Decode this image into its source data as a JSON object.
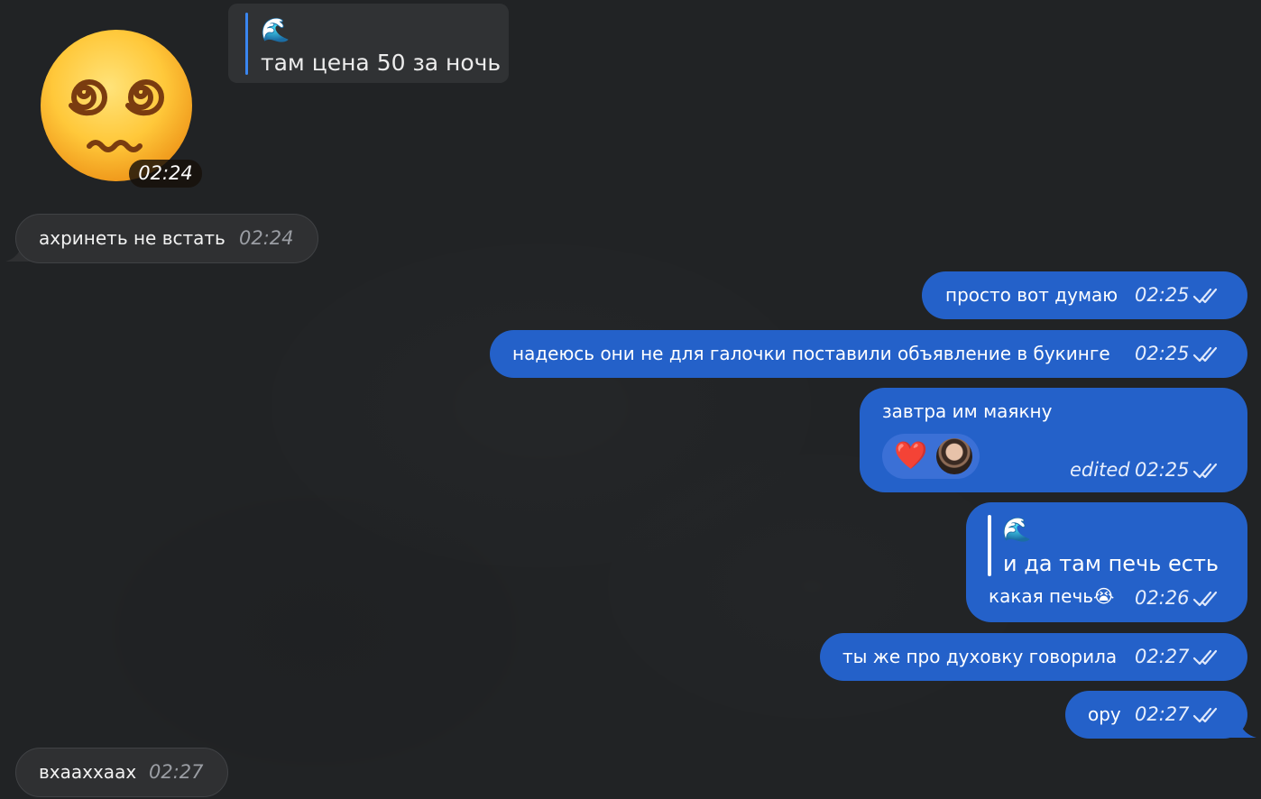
{
  "forwarded_quote": {
    "emoji": "🌊",
    "text": "там цена 50 за ночь"
  },
  "sticker": {
    "icon": "dizzy-face-sticker",
    "time": "02:24"
  },
  "messages_in": [
    {
      "text": "ахринеть не встать",
      "time": "02:24"
    },
    {
      "text": "вхааххаах",
      "time": "02:27"
    }
  ],
  "messages_out": [
    {
      "text": "просто вот думаю",
      "time": "02:25"
    },
    {
      "text": "надеюсь они не для галочки поставили объявление в букинге",
      "time": "02:25"
    },
    {
      "text": "завтра им маякну",
      "time": "02:25",
      "edited_label": "edited",
      "reaction": {
        "emoji": "❤️",
        "icon": "user-avatar"
      }
    },
    {
      "quote_emoji": "🌊",
      "quote_text": "и да там печь есть",
      "text": "какая печь😭",
      "time": "02:26"
    },
    {
      "text": "ты же про духовку говорила",
      "time": "02:27"
    },
    {
      "text": "ору",
      "time": "02:27"
    }
  ],
  "colors": {
    "background": "#212325",
    "outgoing": "#2461c9",
    "incoming": "#2f3032",
    "quote_bar": "#3a86f0"
  }
}
